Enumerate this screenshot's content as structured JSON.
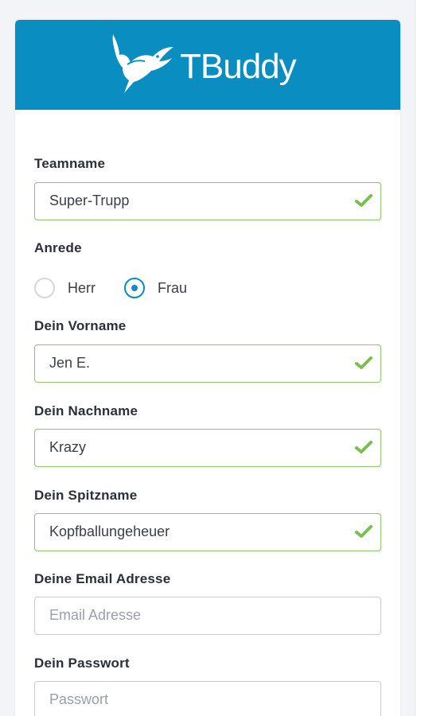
{
  "brand": {
    "name": "TBuddy",
    "header_color": "#0a8dc0"
  },
  "form": {
    "teamname": {
      "label": "Teamname",
      "value": "Super-Trupp",
      "placeholder": "",
      "valid": true
    },
    "salutation": {
      "label": "Anrede",
      "options": [
        {
          "label": "Herr",
          "selected": false
        },
        {
          "label": "Frau",
          "selected": true
        }
      ]
    },
    "firstname": {
      "label": "Dein Vorname",
      "value": "Jen E.",
      "valid": true
    },
    "lastname": {
      "label": "Dein Nachname",
      "value": "Krazy",
      "valid": true
    },
    "nickname": {
      "label": "Dein Spitzname",
      "value": "Kopfballungeheuer",
      "valid": true
    },
    "email": {
      "label": "Deine Email Adresse",
      "value": "",
      "placeholder": "Email Adresse"
    },
    "password": {
      "label": "Dein Passwort",
      "value": "",
      "placeholder": "Passwort"
    }
  },
  "colors": {
    "accent": "#0a8dc0",
    "valid_border": "#8cc56a",
    "check": "#7cbd4e"
  },
  "icons": {
    "valid": "check-icon",
    "logo": "bird-logo-icon"
  }
}
